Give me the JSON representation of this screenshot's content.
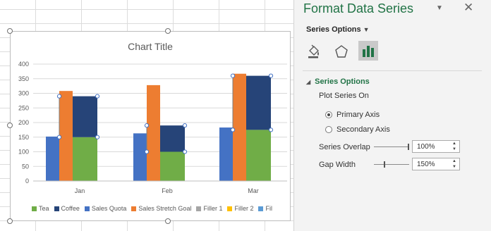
{
  "chart": {
    "title": "Chart Title",
    "legend": [
      {
        "label": "Tea",
        "color": "#70ad47"
      },
      {
        "label": "Coffee",
        "color": "#264478"
      },
      {
        "label": "Sales Quota",
        "color": "#4472c4"
      },
      {
        "label": "Sales Stretch Goal",
        "color": "#ed7d31"
      },
      {
        "label": "Filler 1",
        "color": "#a5a5a5"
      },
      {
        "label": "Filler 2",
        "color": "#ffc000"
      },
      {
        "label": "Fil",
        "color": "#5b9bd5"
      }
    ]
  },
  "chart_data": {
    "type": "bar",
    "categories": [
      "Jan",
      "Feb",
      "Mar"
    ],
    "ylim": [
      0,
      400
    ],
    "yticks": [
      0,
      50,
      100,
      150,
      200,
      250,
      300,
      350,
      400
    ],
    "grid": true,
    "legend_position": "bottom",
    "title": "Chart Title",
    "series": [
      {
        "name": "Sales Quota",
        "values": [
          152,
          163,
          183
        ],
        "color": "#4472c4"
      },
      {
        "name": "Sales Stretch Goal",
        "values": [
          308,
          328,
          367
        ],
        "color": "#ed7d31"
      },
      {
        "name": "Tea",
        "values": [
          150,
          100,
          175
        ],
        "color": "#70ad47"
      },
      {
        "name": "Coffee",
        "values": [
          140,
          90,
          185
        ],
        "color": "#264478",
        "stacked_on": "Tea"
      }
    ]
  },
  "pane": {
    "title": "Format Data Series",
    "dropdown_icon": "chevron-down-icon",
    "close_glyph": "✕",
    "series_options_label": "Series Options",
    "tabs": [
      "fill-line-icon",
      "effects-icon",
      "series-options-icon"
    ],
    "section_title": "Series Options",
    "plot_series_on": "Plot Series On",
    "primary_axis": "Primary Axis",
    "secondary_axis": "Secondary Axis",
    "series_overlap_label": "Series Overlap",
    "series_overlap_value": "100%",
    "gap_width_label": "Gap Width",
    "gap_width_value": "150%",
    "series_overlap_level": 1.0,
    "gap_width_level": 0.3
  }
}
